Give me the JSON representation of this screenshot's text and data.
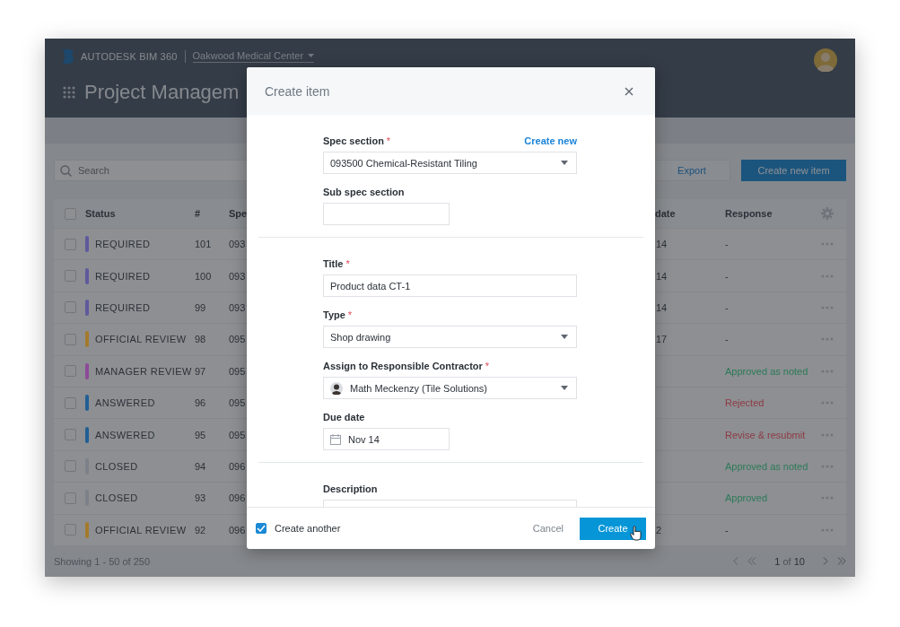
{
  "header": {
    "brand": "AUTODESK BIM 360",
    "project": "Oakwood Medical Center",
    "page_title": "Project Managem"
  },
  "toolbar": {
    "search_placeholder": "Search",
    "export": "Export",
    "create": "Create new item"
  },
  "table": {
    "select_all_checked": false,
    "columns": [
      "Status",
      "#",
      "Spe",
      "date",
      "Response"
    ],
    "rows": [
      {
        "checked": false,
        "status": "REQUIRED",
        "color": "#5e5a9c",
        "number": "101",
        "spec": "093",
        "date": "14",
        "response": {
          "text": "-"
        }
      },
      {
        "checked": false,
        "status": "REQUIRED",
        "color": "#5e5a9c",
        "number": "100",
        "spec": "093",
        "date": "14",
        "response": {
          "text": "-"
        }
      },
      {
        "checked": false,
        "status": "REQUIRED",
        "color": "#5e5a9c",
        "number": "99",
        "spec": "093",
        "date": "14",
        "response": {
          "text": "-"
        }
      },
      {
        "checked": false,
        "status": "OFFICIAL REVIEW",
        "color": "#a47a2c",
        "number": "98",
        "spec": "095",
        "date": "17",
        "response": {
          "text": "-"
        }
      },
      {
        "checked": false,
        "status": "MANAGER REVIEW",
        "color": "#8c4a98",
        "number": "97",
        "spec": "095",
        "response": {
          "text": "Approved as noted",
          "color": "#2c7a58"
        }
      },
      {
        "checked": false,
        "status": "ANSWERED",
        "color": "#215f95",
        "number": "96",
        "spec": "095",
        "response": {
          "text": "Rejected",
          "color": "#8e3a45"
        }
      },
      {
        "checked": false,
        "status": "ANSWERED",
        "color": "#215f95",
        "number": "95",
        "spec": "095",
        "response": {
          "text": "Revise & resubmit",
          "color": "#8e3a45"
        }
      },
      {
        "checked": false,
        "status": "CLOSED",
        "color": "#7c8189",
        "number": "94",
        "spec": "096",
        "response": {
          "text": "Approved as noted",
          "color": "#2c7a58"
        }
      },
      {
        "checked": false,
        "status": "CLOSED",
        "color": "#7c8189",
        "number": "93",
        "spec": "096",
        "response": {
          "text": "Approved",
          "color": "#2c7a58"
        }
      },
      {
        "checked": false,
        "status": "OFFICIAL REVIEW",
        "color": "#a47a2c",
        "number": "92",
        "spec": "096",
        "date": "2",
        "response": {
          "text": "-"
        }
      }
    ]
  },
  "footer": {
    "showing": "Showing 1 - 50 of 250",
    "page": "1",
    "of": "of",
    "total": "10"
  },
  "modal": {
    "title": "Create item",
    "sections": [
      [
        {
          "kind": "select",
          "label": "Spec section",
          "required_mark": "*",
          "link": "Create new",
          "value": "093500 Chemical-Resistant Tiling"
        },
        {
          "kind": "text",
          "label": "Sub spec section"
        }
      ],
      [
        {
          "kind": "text_wide",
          "label": "Title",
          "required_mark": "*",
          "value": "Product data CT-1"
        },
        {
          "kind": "select",
          "label": "Type",
          "required_mark": "*",
          "value": "Shop drawing"
        },
        {
          "kind": "assignee",
          "label": "Assign to Responsible Contractor",
          "required_mark": "*",
          "value": "Math Meckenzy (Tile Solutions)"
        },
        {
          "kind": "date",
          "label": "Due date",
          "value": "Nov 14"
        }
      ],
      [
        {
          "kind": "textarea",
          "label": "Description"
        }
      ]
    ],
    "create_another": {
      "label": "Create another",
      "checked": true
    },
    "cancel": "Cancel",
    "submit": "Create"
  }
}
